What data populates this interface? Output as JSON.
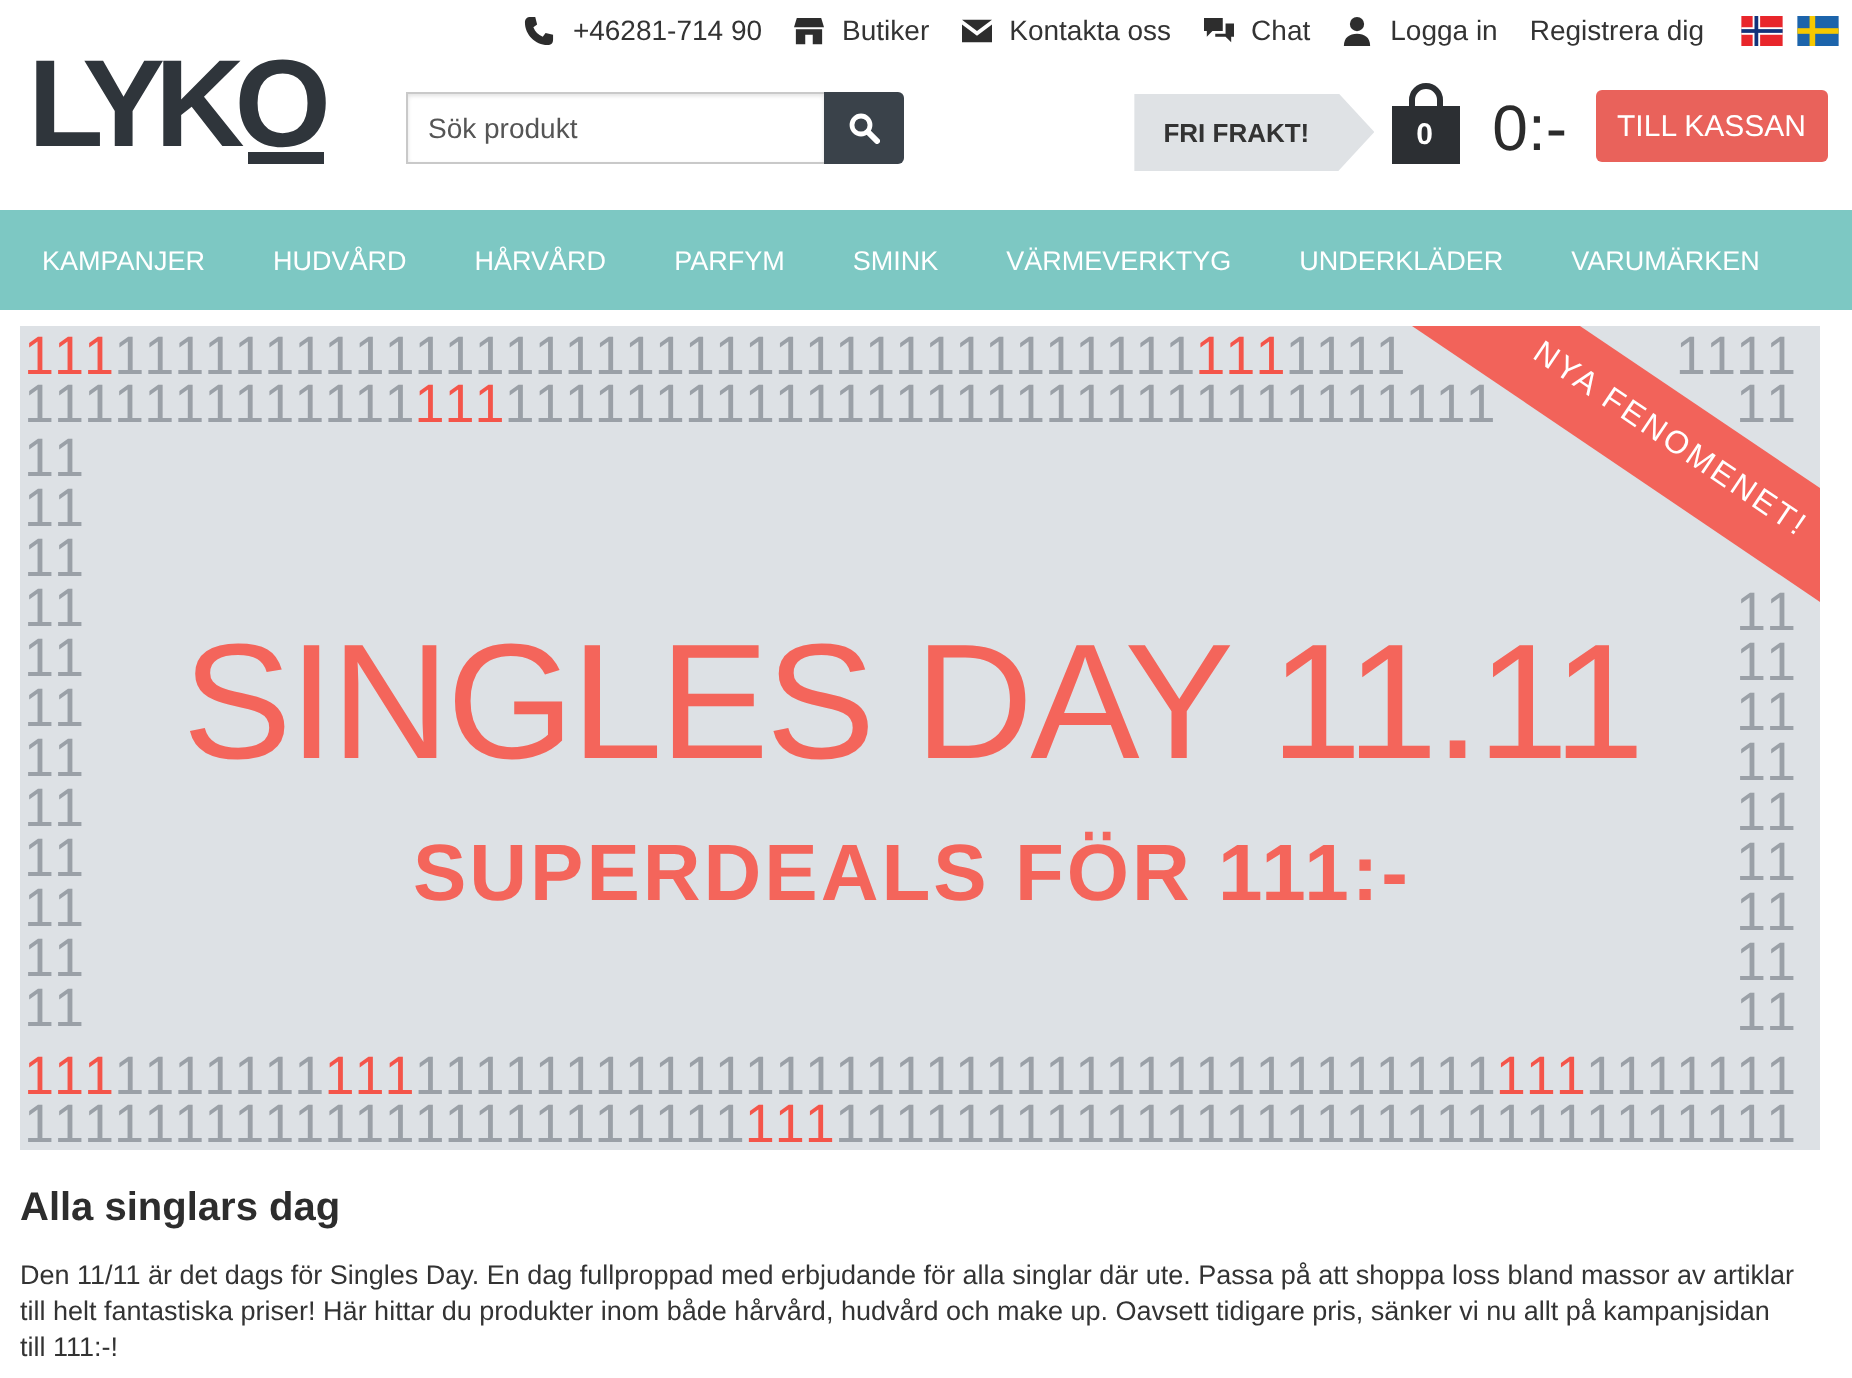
{
  "header": {
    "logo": "LYKO",
    "top_links": [
      {
        "kind": "phone",
        "label": "+46281-714 90"
      },
      {
        "kind": "store",
        "label": "Butiker"
      },
      {
        "kind": "mail",
        "label": "Kontakta oss"
      },
      {
        "kind": "chat",
        "label": "Chat"
      },
      {
        "kind": "user",
        "label": "Logga in"
      },
      {
        "kind": "plain",
        "label": "Registrera dig"
      }
    ],
    "search": {
      "placeholder": "Sök produkt"
    },
    "shipping_tag": "FRI FRAKT!",
    "cart": {
      "count": "0",
      "total": "0:-"
    },
    "checkout_button": "TILL KASSAN"
  },
  "nav": [
    "KAMPANJER",
    "HUDVÅRD",
    "HÅRVÅRD",
    "PARFYM",
    "SMINK",
    "VÄRMEVERKTYG",
    "UNDERKLÄDER",
    "VARUMÄRKEN"
  ],
  "banner": {
    "ribbon": "NYA FENOMENET!",
    "title": "SINGLES DAY 11.11",
    "subtitle": "SUPERDEALS FÖR 111:-",
    "pattern": {
      "top_rows": [
        {
          "left": [
            {
              "text": "111",
              "highlight": true
            },
            {
              "text": "111111111111111111111111111111111111",
              "highlight": false
            },
            {
              "text": "111",
              "highlight": true
            },
            {
              "text": "1111",
              "highlight": false
            }
          ],
          "right": [
            {
              "text": "1111",
              "highlight": false
            }
          ]
        },
        {
          "left": [
            {
              "text": "1111111111111",
              "highlight": false
            },
            {
              "text": "111",
              "highlight": true
            },
            {
              "text": "111111111111111111111111111111111",
              "highlight": false
            }
          ],
          "right": [
            {
              "text": "11",
              "highlight": false
            }
          ]
        }
      ],
      "left_column": [
        "11",
        "11",
        "11",
        "11",
        "11",
        "11",
        "11",
        "11",
        "11",
        "11",
        "11",
        "11"
      ],
      "right_column": [
        "11",
        "11",
        "11",
        "11",
        "11",
        "11",
        "11",
        "11",
        "11"
      ],
      "bottom_rows": [
        {
          "left": [
            {
              "text": "111",
              "highlight": true
            },
            {
              "text": "1111111",
              "highlight": false
            },
            {
              "text": "111",
              "highlight": true
            },
            {
              "text": "111111111111111111111111111111111111",
              "highlight": false
            },
            {
              "text": "111",
              "highlight": true
            },
            {
              "text": "11111",
              "highlight": false
            }
          ],
          "right": [
            {
              "text": "11",
              "highlight": false
            }
          ]
        },
        {
          "left": [
            {
              "text": "111111111111111111111111",
              "highlight": false
            },
            {
              "text": "111",
              "highlight": true
            },
            {
              "text": "11111111111111111111111111111111",
              "highlight": false
            }
          ]
        }
      ]
    }
  },
  "article": {
    "heading": "Alla singlars dag",
    "body": "Den 11/11 är det dags för Singles Day. En dag fullproppad med erbjudande för alla singlar där ute. Passa på att shoppa loss bland massor av artiklar till helt fantastiska priser! Här hittar du produkter inom både hårvård, hudvård och make up. Oavsett tidigare pris, sänker vi nu allt på kampanjsidan till 111:-!"
  }
}
